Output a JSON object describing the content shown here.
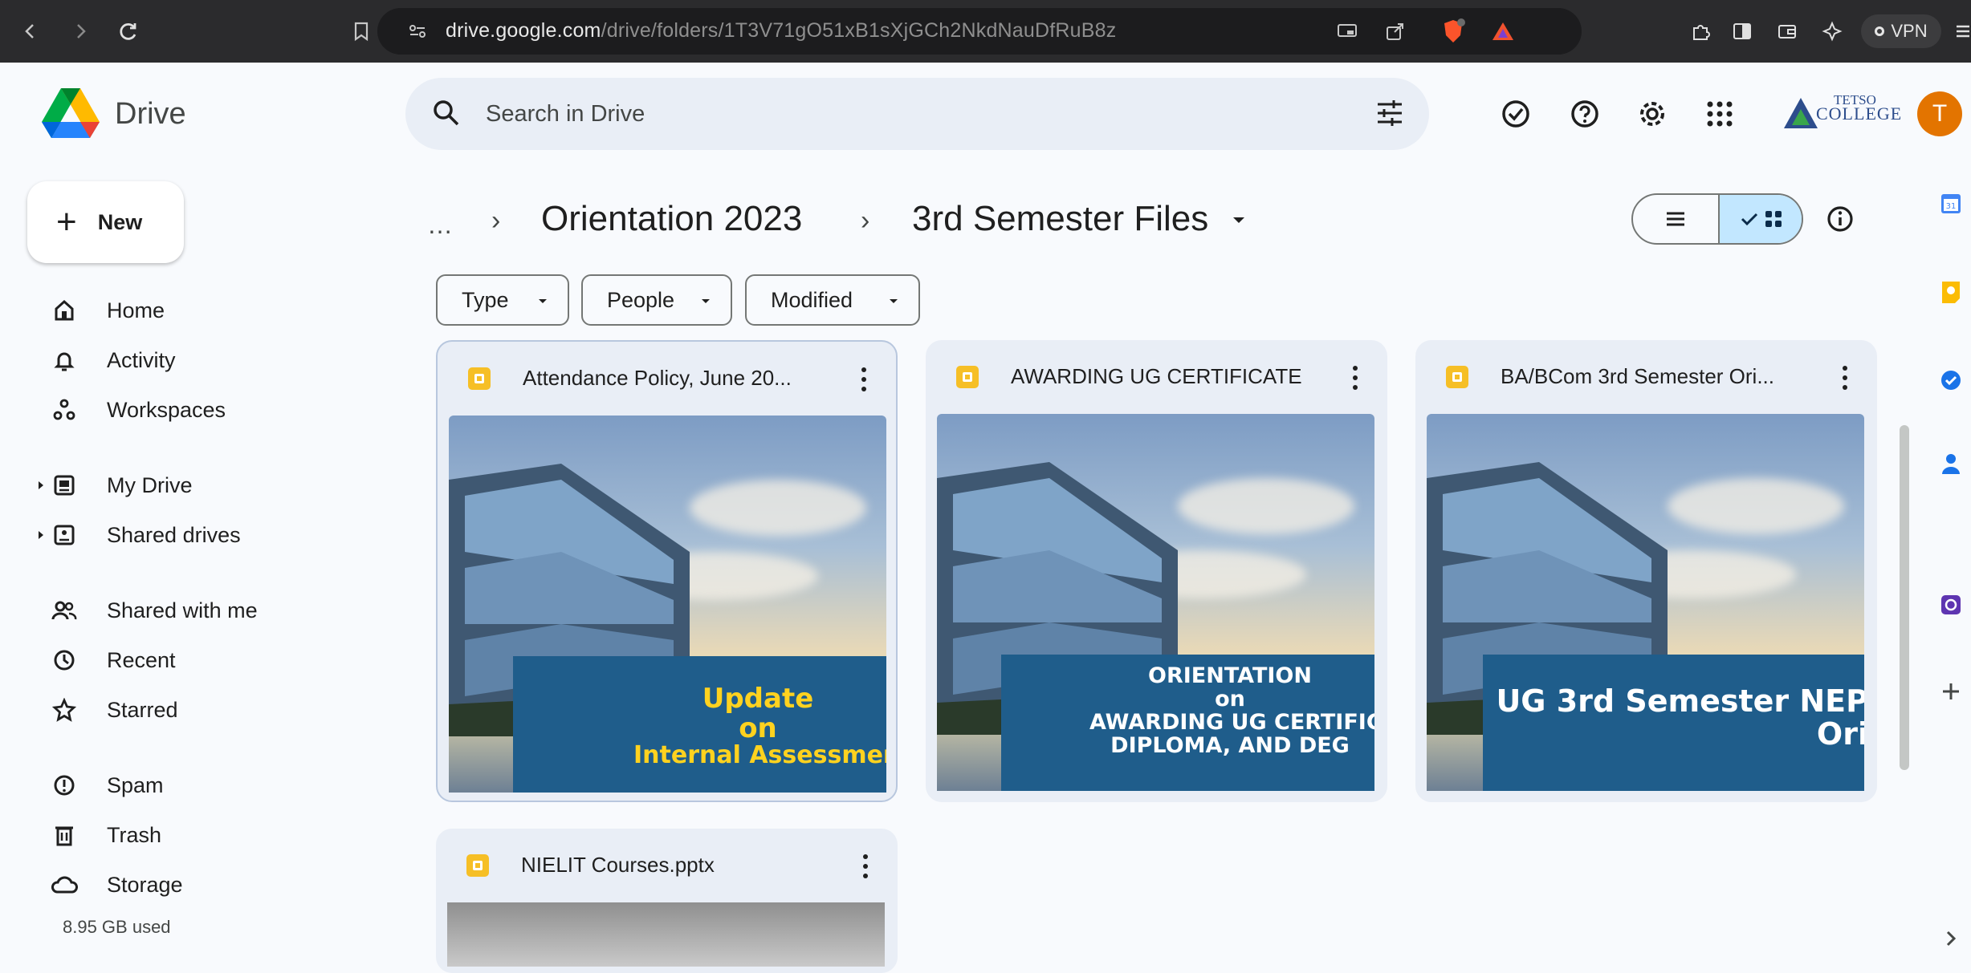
{
  "browser": {
    "url_host": "drive.google.com",
    "url_path": "/drive/folders/1T3V71gO51xB1sXjGCh2NkdNauDfRuB8z",
    "vpn_label": "VPN"
  },
  "header": {
    "app_name": "Drive",
    "search_placeholder": "Search in Drive",
    "org_logo_line1": "TETSO",
    "org_logo_line2": "COLLEGE",
    "avatar_letter": "T"
  },
  "sidebar": {
    "new_label": "New",
    "items": [
      {
        "label": "Home",
        "icon": "home-icon"
      },
      {
        "label": "Activity",
        "icon": "bell-icon"
      },
      {
        "label": "Workspaces",
        "icon": "workspaces-icon"
      },
      {
        "label": "My Drive",
        "icon": "my-drive-icon"
      },
      {
        "label": "Shared drives",
        "icon": "shared-drives-icon"
      },
      {
        "label": "Shared with me",
        "icon": "people-icon"
      },
      {
        "label": "Recent",
        "icon": "clock-icon"
      },
      {
        "label": "Starred",
        "icon": "star-icon"
      },
      {
        "label": "Spam",
        "icon": "spam-icon"
      },
      {
        "label": "Trash",
        "icon": "trash-icon"
      },
      {
        "label": "Storage",
        "icon": "cloud-icon"
      }
    ],
    "storage_used": "8.95 GB used"
  },
  "main": {
    "breadcrumb": {
      "more": "…",
      "parent": "Orientation 2023",
      "current": "3rd Semester Files"
    },
    "filters": [
      "Type",
      "People",
      "Modified"
    ],
    "files": [
      {
        "title": "Attendance Policy, June 20...",
        "thumb_lines": [
          "Update",
          "on",
          "Internal Assessment Str"
        ]
      },
      {
        "title": "AWARDING UG CERTIFICATE",
        "thumb_lines": [
          "ORIENTATION",
          "on",
          "AWARDING UG CERTIFIC",
          "DIPLOMA, AND DEG"
        ]
      },
      {
        "title": "BA/BCom 3rd Semester Ori...",
        "thumb_lines": [
          "UG 3rd Semester NEP",
          "Ori"
        ]
      },
      {
        "title": "NIELIT Courses.pptx",
        "thumb_lines": []
      }
    ]
  },
  "colors": {
    "accent": "#c2e7ff",
    "file_slides": "#f6bf26",
    "banner": "#1f5d8b",
    "avatar": "#e37400"
  }
}
